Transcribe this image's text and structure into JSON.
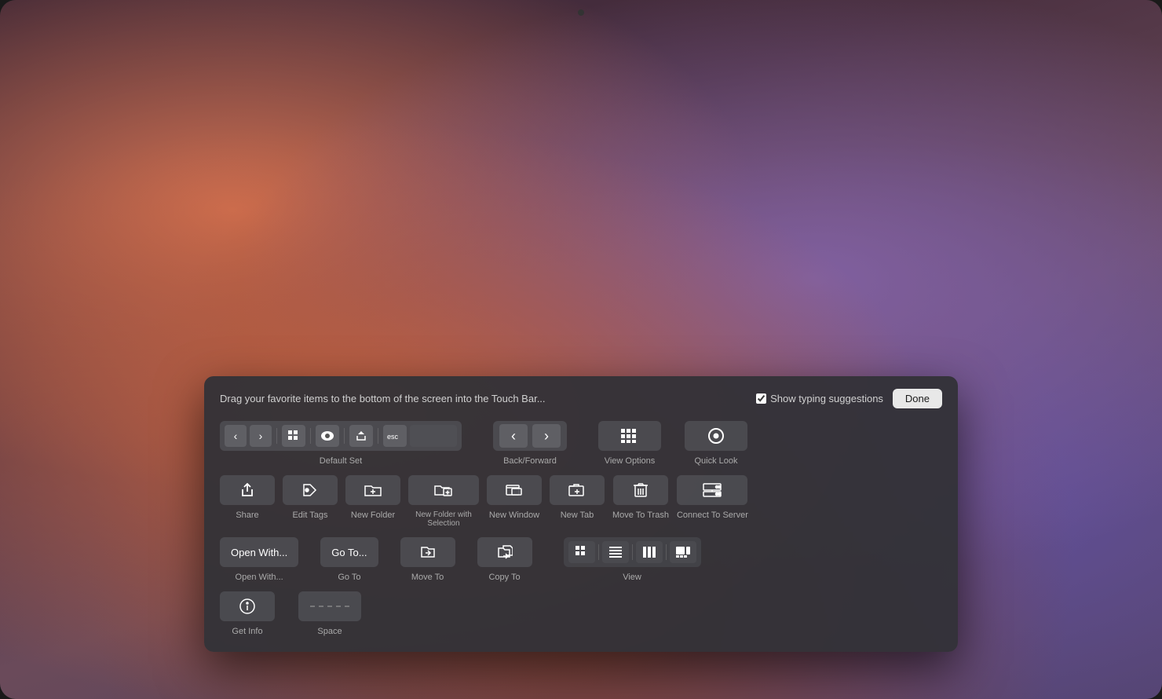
{
  "macbook": {
    "bg_description": "macOS desktop with warm sunset blur background"
  },
  "dialog": {
    "instruction": "Drag your favorite items to the bottom of the screen into the Touch Bar...",
    "show_typing_label": "Show typing suggestions",
    "done_button": "Done",
    "rows": [
      {
        "id": "row1",
        "items": [
          {
            "id": "default-set",
            "label": "Default Set",
            "type": "default-set-bar"
          },
          {
            "id": "back-forward",
            "label": "Back/Forward",
            "type": "back-forward"
          },
          {
            "id": "view-options",
            "label": "View Options",
            "type": "icon-label"
          },
          {
            "id": "quick-look",
            "label": "Quick Look",
            "type": "icon-label"
          }
        ]
      },
      {
        "id": "row2",
        "items": [
          {
            "id": "share",
            "label": "Share",
            "type": "action"
          },
          {
            "id": "edit-tags",
            "label": "Edit Tags",
            "type": "action"
          },
          {
            "id": "new-folder",
            "label": "New Folder",
            "type": "action"
          },
          {
            "id": "new-folder-selection",
            "label": "New Folder with\nSelection",
            "type": "action-wide"
          },
          {
            "id": "new-window",
            "label": "New Window",
            "type": "action"
          },
          {
            "id": "new-tab",
            "label": "New Tab",
            "type": "action"
          },
          {
            "id": "move-to-trash",
            "label": "Move To Trash",
            "type": "action"
          },
          {
            "id": "connect-to-server",
            "label": "Connect To Server",
            "type": "action-wide"
          }
        ]
      },
      {
        "id": "row3",
        "items": [
          {
            "id": "open-with",
            "label": "Open With...",
            "type": "text-btn",
            "button_text": "Open With..."
          },
          {
            "id": "go-to",
            "label": "Go To",
            "type": "text-btn",
            "button_text": "Go To..."
          },
          {
            "id": "move-to",
            "label": "Move To",
            "type": "icon-label"
          },
          {
            "id": "copy-to",
            "label": "Copy To",
            "type": "icon-label"
          },
          {
            "id": "view-group",
            "label": "View",
            "type": "view-bar"
          }
        ]
      },
      {
        "id": "row4",
        "items": [
          {
            "id": "get-info",
            "label": "Get Info",
            "type": "action"
          },
          {
            "id": "space",
            "label": "Space",
            "type": "space"
          }
        ]
      }
    ]
  }
}
